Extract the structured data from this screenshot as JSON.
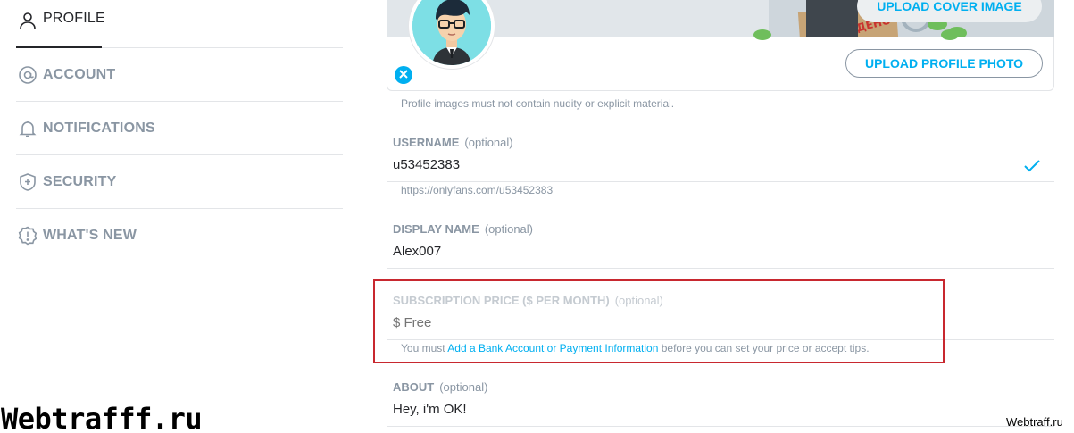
{
  "sidebar": {
    "items": [
      {
        "label": "PROFILE",
        "icon": "person-icon"
      },
      {
        "label": "ACCOUNT",
        "icon": "at-icon"
      },
      {
        "label": "NOTIFICATIONS",
        "icon": "bell-icon"
      },
      {
        "label": "SECURITY",
        "icon": "shield-icon"
      },
      {
        "label": "WHAT'S NEW",
        "icon": "alert-badge-icon"
      }
    ]
  },
  "cover": {
    "upload_cover_label": "UPLOAD COVER IMAGE",
    "upload_profile_label": "UPLOAD PROFILE PHOTO",
    "stamp_text": "ДЕНО",
    "notice": "Profile images must not contain nudity or explicit material."
  },
  "form": {
    "username": {
      "label": "USERNAME",
      "optional": "(optional)",
      "value": "u53452383",
      "hint": "https://onlyfans.com/u53452383"
    },
    "display_name": {
      "label": "DISPLAY NAME",
      "optional": "(optional)",
      "value": "Alex007"
    },
    "subscription": {
      "label": "SUBSCRIPTION PRICE ($ PER MONTH)",
      "optional": "(optional)",
      "placeholder": "$ Free",
      "hint_before": "You must ",
      "hint_link": "Add a Bank Account or Payment Information",
      "hint_after": " before you can set your price or accept tips."
    },
    "about": {
      "label": "ABOUT",
      "optional": "(optional)",
      "value": "Hey, i'm OK!"
    }
  },
  "watermarks": {
    "left": "Webtrafff.ru",
    "right": "Webtraff.ru"
  },
  "colors": {
    "accent": "#00aff0",
    "muted": "#8a96a3",
    "highlight_border": "#c8282f"
  }
}
